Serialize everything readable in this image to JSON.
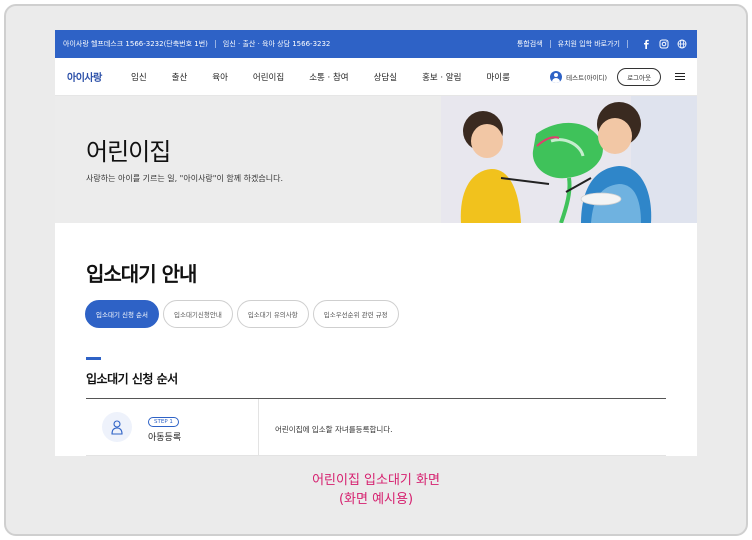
{
  "topbar": {
    "helpdesk": "아이사랑 헬프데스크 1566-3232(단축번호 1번)",
    "consult": "임신 · 출산 · 육아 상담 1566-3232",
    "search": "통합검색",
    "kindergarten": "유치원 입학 바로가기"
  },
  "nav": {
    "logo": "아이사랑",
    "menu": [
      "임신",
      "출산",
      "육아",
      "어린이집",
      "소통 · 참여",
      "상담실",
      "홍보 · 알림",
      "마이룸"
    ],
    "user_name": "테스트(아이디)",
    "logout": "로그아웃"
  },
  "hero": {
    "title": "어린이집",
    "subtitle": "사랑하는 아이를 기르는 일, \"아이사랑\"이 함께 하겠습니다."
  },
  "page": {
    "title": "입소대기 안내",
    "tabs": [
      "입소대기 신청 순서",
      "입소대기신청안내",
      "입소대기 유의사항",
      "입소우선순위 관련 규정"
    ],
    "section_title": "입소대기 신청 순서",
    "step": {
      "badge": "STEP 1",
      "name": "아동등록",
      "desc": "어린이집에 입소할 자녀를등록합니다."
    }
  },
  "caption": {
    "line1": "어린이집 입소대기 화면",
    "line2": "(화면 예시용)"
  },
  "colors": {
    "brand": "#2e62c6",
    "caption": "#d6206f"
  }
}
